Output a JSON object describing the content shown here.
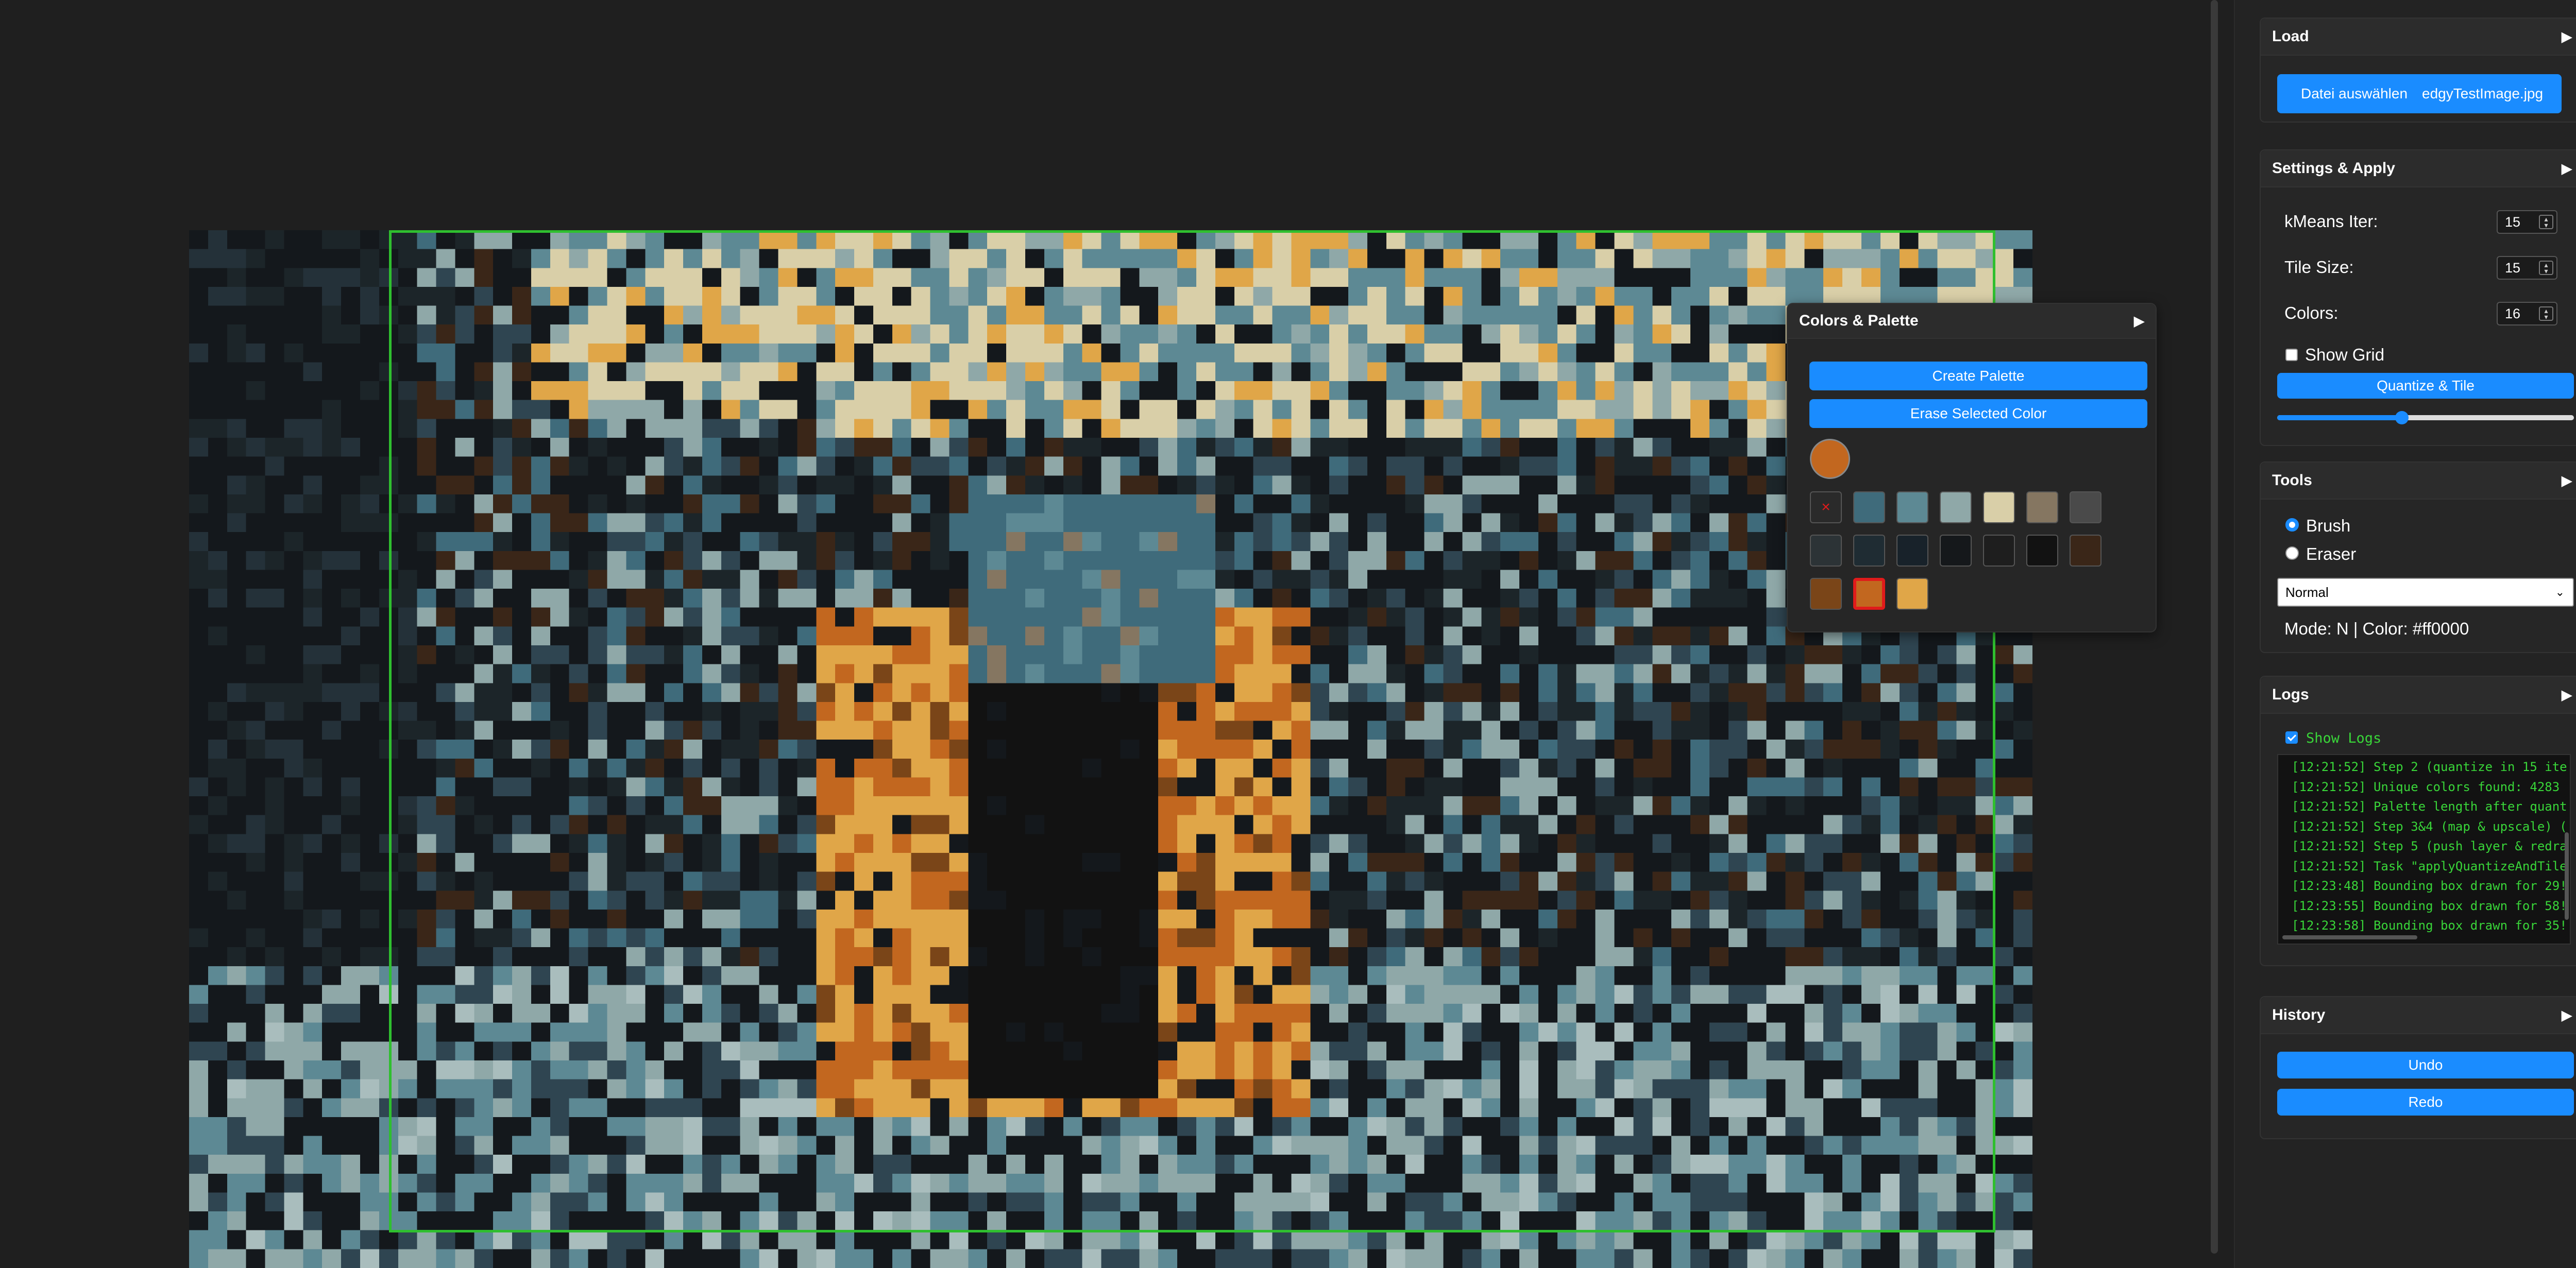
{
  "load": {
    "title": "Load",
    "choose_label": "Datei auswählen",
    "file_name": "edgyTestImage.jpg"
  },
  "settings": {
    "title": "Settings & Apply",
    "kmeans_label": "kMeans Iter:",
    "kmeans_value": "15",
    "tile_label": "Tile Size:",
    "tile_value": "15",
    "colors_label": "Colors:",
    "colors_value": "16",
    "grid_label": "Show Grid",
    "grid_checked": false,
    "apply_label": "Quantize & Tile",
    "slider_value": 0.42
  },
  "tools": {
    "title": "Tools",
    "brush_label": "Brush",
    "eraser_label": "Eraser",
    "selected_tool": "Brush",
    "mode_selected": "Normal",
    "status": "Mode: N | Color: #ff0000"
  },
  "logs": {
    "title": "Logs",
    "show_label": "Show Logs",
    "show_checked": true,
    "lines": [
      "[12:21:52] Step 2 (quantize in 15 ite",
      "[12:21:52] Unique colors found: 4283",
      "[12:21:52] Palette length after quant",
      "[12:21:52] Step 3&4 (map & upscale) (",
      "[12:21:52] Step 5 (push layer & redra",
      "[12:21:52] Task \"applyQuantizeAndTile",
      "[12:23:48] Bounding box drawn for 29!",
      "[12:23:55] Bounding box drawn for 58!",
      "[12:23:58] Bounding box drawn for 35!"
    ]
  },
  "history": {
    "title": "History",
    "undo_label": "Undo",
    "redo_label": "Redo"
  },
  "colors_panel": {
    "title": "Colors & Palette",
    "create_label": "Create Palette",
    "erase_label": "Erase Selected Color",
    "current_color": "#c2671f",
    "erase_swatch_icon": "×",
    "palette": [
      "#3f6b7b",
      "#5d8994",
      "#8fa8a8",
      "#d9cfa8",
      "#857661",
      "#4a4a4a",
      "#2c3336",
      "#1f2c33",
      "#18222a",
      "#15181b",
      "#1e1e1e",
      "#121212",
      "#3a2618",
      "#7a4518",
      "#c2671f",
      "#e0a648"
    ],
    "selected_index": 14
  },
  "canvas_colors": [
    "#14181c",
    "#1c2529",
    "#243139",
    "#2f4551",
    "#3f6b7b",
    "#5d8994",
    "#8fa8a8",
    "#a9bdbd",
    "#d9cfa8",
    "#857661",
    "#4a4a4a",
    "#2c3336",
    "#e0a648",
    "#c2671f",
    "#7a4518",
    "#3a2618",
    "#121212"
  ],
  "accent": "#1a8cff",
  "bbox_color": "#2fbf2f"
}
